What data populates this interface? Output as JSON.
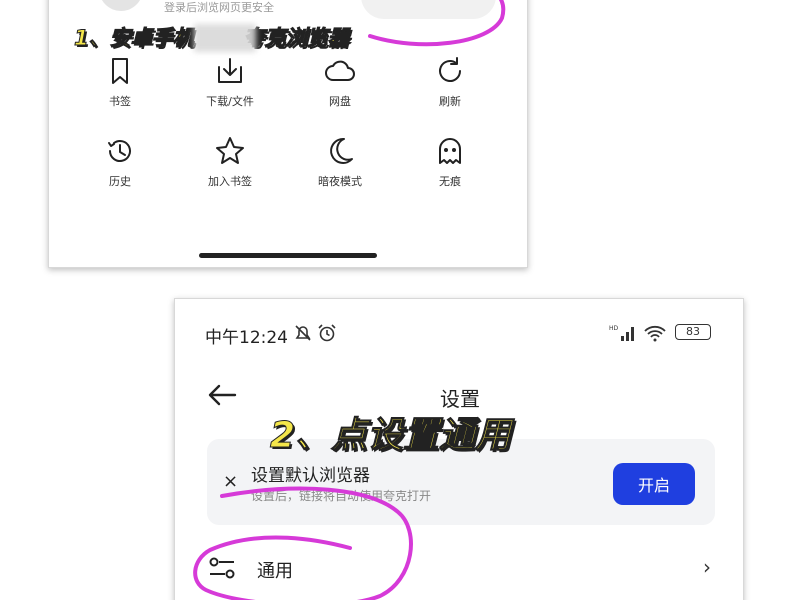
{
  "shot1": {
    "login_hint": "登录后浏览网页更安全",
    "menu_items": [
      {
        "label": "书签",
        "icon": "bookmark-icon"
      },
      {
        "label": "下载/文件",
        "icon": "download-icon"
      },
      {
        "label": "网盘",
        "icon": "cloud-icon"
      },
      {
        "label": "刷新",
        "icon": "refresh-icon"
      },
      {
        "label": "历史",
        "icon": "history-icon"
      },
      {
        "label": "加入书签",
        "icon": "star-icon"
      },
      {
        "label": "暗夜模式",
        "icon": "moon-icon"
      },
      {
        "label": "无痕",
        "icon": "ghost-icon"
      }
    ]
  },
  "shot2": {
    "status_time": "中午12:24",
    "battery": "83",
    "page_title": "设置",
    "banner": {
      "close": "×",
      "title": "设置默认浏览器",
      "subtitle": "设置后，链接将自动使用夸克打开",
      "button": "开启"
    },
    "general": {
      "label": "通用",
      "chevron": "›"
    }
  },
  "annotations": {
    "step1": "1、安卓手机",
    "step1_tail": "夸克浏览器",
    "step2": "2、点设置通用"
  },
  "colors": {
    "accent_button": "#1f3fe0",
    "annotation_text": "#f4e64a",
    "annotation_ink": "#d63ad8"
  }
}
